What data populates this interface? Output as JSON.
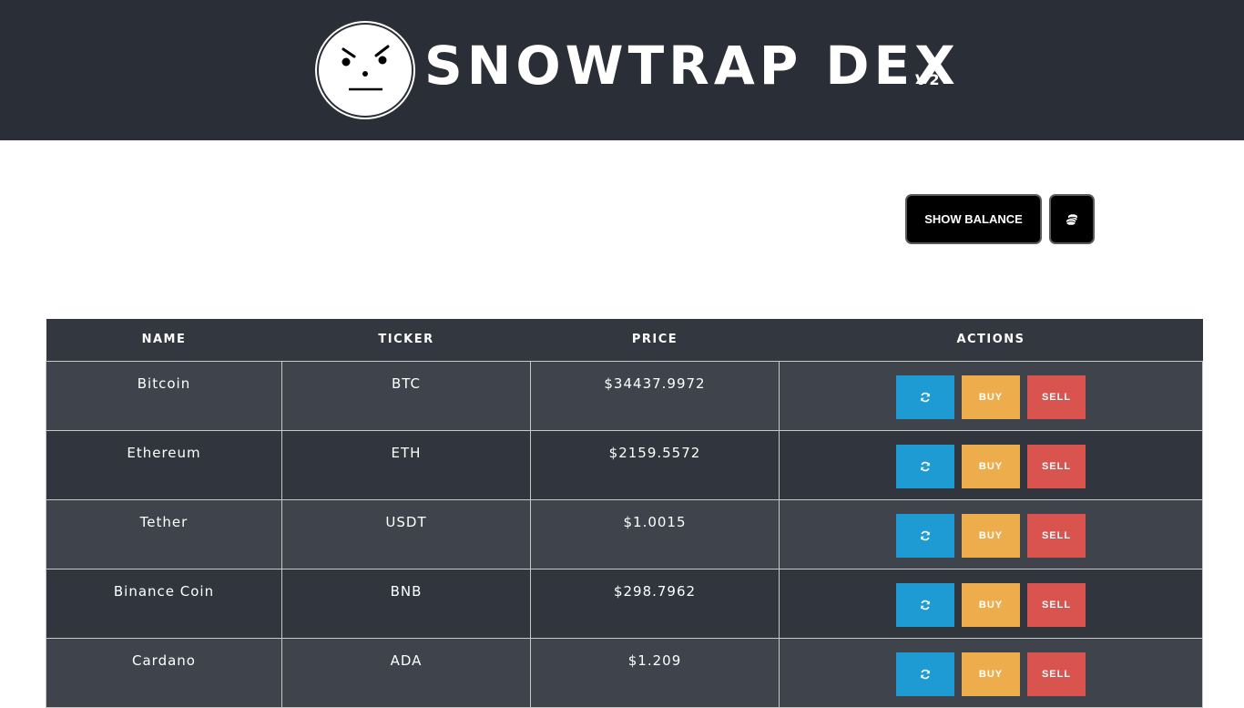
{
  "header": {
    "title": "SNOWTRAP DEX",
    "version": "V2",
    "logo_icon": "angry-face-icon"
  },
  "toolbar": {
    "show_balance_label": "SHOW BALANCE",
    "coins_icon": "coins-icon"
  },
  "table": {
    "columns": [
      "NAME",
      "TICKER",
      "PRICE",
      "ACTIONS"
    ],
    "rows": [
      {
        "name": "Bitcoin",
        "ticker": "BTC",
        "price": "$34437.9972"
      },
      {
        "name": "Ethereum",
        "ticker": "ETH",
        "price": "$2159.5572"
      },
      {
        "name": "Tether",
        "ticker": "USDT",
        "price": "$1.0015"
      },
      {
        "name": "Binance Coin",
        "ticker": "BNB",
        "price": "$298.7962"
      },
      {
        "name": "Cardano",
        "ticker": "ADA",
        "price": "$1.209"
      }
    ],
    "actions": {
      "refresh_icon": "refresh-icon",
      "buy_label": "BUY",
      "sell_label": "SELL"
    }
  },
  "colors": {
    "header_bg": "#2a2e36",
    "refresh": "#1f9bd4",
    "buy": "#eead4c",
    "sell": "#d9534f"
  }
}
